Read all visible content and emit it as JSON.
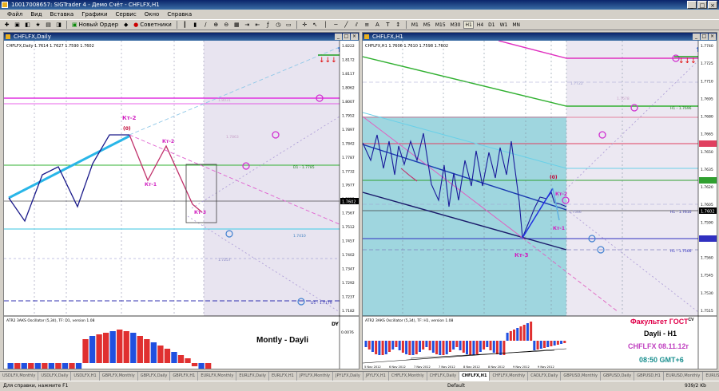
{
  "window": {
    "title": "10017008657: SIGTrader 4 - Демо Счёт - CHFLFX,H1",
    "buttons": [
      "_",
      "□",
      "×"
    ]
  },
  "menu": [
    "Файл",
    "Вид",
    "Вставка",
    "Графики",
    "Сервис",
    "Окно",
    "Справка"
  ],
  "toolbar": {
    "new_order": "Новый Ордер",
    "advisors": "Советники",
    "timeframes": [
      "M1",
      "M5",
      "M15",
      "M30",
      "H1",
      "H4",
      "D1",
      "W1",
      "MN"
    ],
    "active_tf": "H1"
  },
  "left_chart": {
    "title": "CHFLFX,Daily",
    "info": "CHFLFX,Daily 1.7614 1.7627 1.7590 1.7602",
    "price_ticks": [
      "1.8222",
      "1.8172",
      "1.8117",
      "1.8062",
      "1.8007",
      "1.7952",
      "1.7897",
      "1.7842",
      "1.7787",
      "1.7732",
      "1.7677",
      "1.7622",
      "1.7567",
      "1.7512",
      "1.7457",
      "1.7402",
      "1.7347",
      "1.7292",
      "1.7237",
      "1.7182"
    ],
    "price_marker": "1.7602",
    "labels": {
      "zero": "(0)",
      "kt1": "Кт-1",
      "kt2a": "Кт-2",
      "kt2b": "Кт-2",
      "kt3": "Кт-3"
    },
    "fib_labels": [
      "1.8031",
      "1.7863",
      "D1 - 1.7785",
      "1.7410",
      "1.7257",
      "D1 - 1.7179"
    ],
    "osc_title": "ATR2 ЗАКS Oscillator (5,34), TF: D1, version 1.08",
    "osc_tick": "0.0076",
    "dy": "DY",
    "caption": "Montly - Dayli"
  },
  "right_chart": {
    "title": "CHFLFX,H1",
    "info": "CHFLFX,H1 1.7606 1.7610 1.7598 1.7602",
    "price_ticks": [
      "1.7740",
      "1.7725",
      "1.7710",
      "1.7695",
      "1.7680",
      "1.7665",
      "1.7650",
      "1.7635",
      "1.7620",
      "1.7605",
      "1.7590",
      "1.7575",
      "1.7560",
      "1.7545",
      "1.7530",
      "1.7515"
    ],
    "price_marker": "1.7602",
    "labels": {
      "zero": "(0)",
      "kt1": "Кт-1",
      "kt2": "Кт-2",
      "kt3": "Кт-3"
    },
    "fib_labels": [
      "1.7722",
      "H1 - 1.7696",
      "1.7678",
      "H1 - 1.7610",
      "1.7566",
      "H1 - 1.7566"
    ],
    "osc_title": "ATR2 ЗАКS Oscillator (5,34), TF: H1, version 1.08",
    "date_ticks": [
      "5 Nov 2012",
      "6 Nov 2012",
      "7 Nov 2012",
      "7 Nov 2012",
      "8 Nov 2012",
      "8 Nov 2012",
      "9 Nov 2012",
      "9 Nov 2012"
    ]
  },
  "overlay": {
    "line1": "Факультет ГОСТ",
    "line1_sup": "CV",
    "line2": "Dayli - H1",
    "line3": "CHFLFX 08.11.12г",
    "line4": "08:50 GMT+6",
    "colors": {
      "line1": "#e0004a",
      "line2": "#000000",
      "line3": "#c040c0",
      "line4": "#1a8f8f"
    }
  },
  "tabs": [
    "USDLFX,Monthly",
    "USDLFX,Daily",
    "USDLFX,H1",
    "GBPLFX,Monthly",
    "GBPLFX,Daily",
    "GBPLFX,H1",
    "EURLFX,Monthly",
    "EURLFX,Daily",
    "EURLFX,H1",
    "JPYLFX,Monthly",
    "JPYLFX,Daily",
    "JPYLFX,H1",
    "CHFLFX,Monthly",
    "CHFLFX,Daily",
    "CHFLFX,H1",
    "CHFLFX,Monthly",
    "CADLFX,Daily",
    "GBPUSD,Monthly",
    "GBPUSD,Daily",
    "GBPUSD,H1",
    "EURUSD,Monthly",
    "EURUSD,Daily",
    "EURUSD,H1"
  ],
  "active_tab": "CHFLFX,H1",
  "status": {
    "help": "Для справки, нажмите F1",
    "profile": "Default",
    "traffic": "939/2 Kb"
  }
}
